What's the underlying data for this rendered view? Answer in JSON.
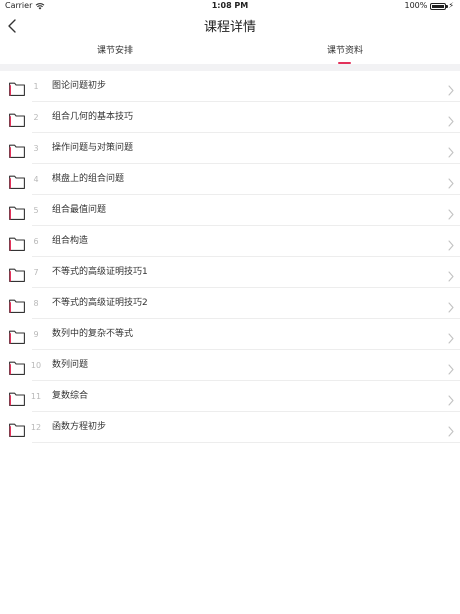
{
  "status_bar": {
    "carrier": "Carrier",
    "time": "1:08 PM",
    "battery": "100%",
    "icons": [
      "wifi-icon",
      "battery-icon",
      "charging-icon"
    ]
  },
  "nav": {
    "title": "课程详情",
    "back_icon": "chevron-left-icon"
  },
  "tabs": [
    {
      "label": "课节安排",
      "active": false
    },
    {
      "label": "课节资料",
      "active": true
    }
  ],
  "colors": {
    "accent": "#e2315a",
    "separator": "#f2f2f4"
  },
  "items": [
    {
      "index": "1",
      "title": "图论问题初步"
    },
    {
      "index": "2",
      "title": "组合几何的基本技巧"
    },
    {
      "index": "3",
      "title": "操作问题与对策问题"
    },
    {
      "index": "4",
      "title": "棋盘上的组合问题"
    },
    {
      "index": "5",
      "title": "组合最值问题"
    },
    {
      "index": "6",
      "title": "组合构造"
    },
    {
      "index": "7",
      "title": "不等式的高级证明技巧1"
    },
    {
      "index": "8",
      "title": "不等式的高级证明技巧2"
    },
    {
      "index": "9",
      "title": "数列中的复杂不等式"
    },
    {
      "index": "10",
      "title": "数列问题"
    },
    {
      "index": "11",
      "title": "复数综合"
    },
    {
      "index": "12",
      "title": "函数方程初步"
    }
  ]
}
